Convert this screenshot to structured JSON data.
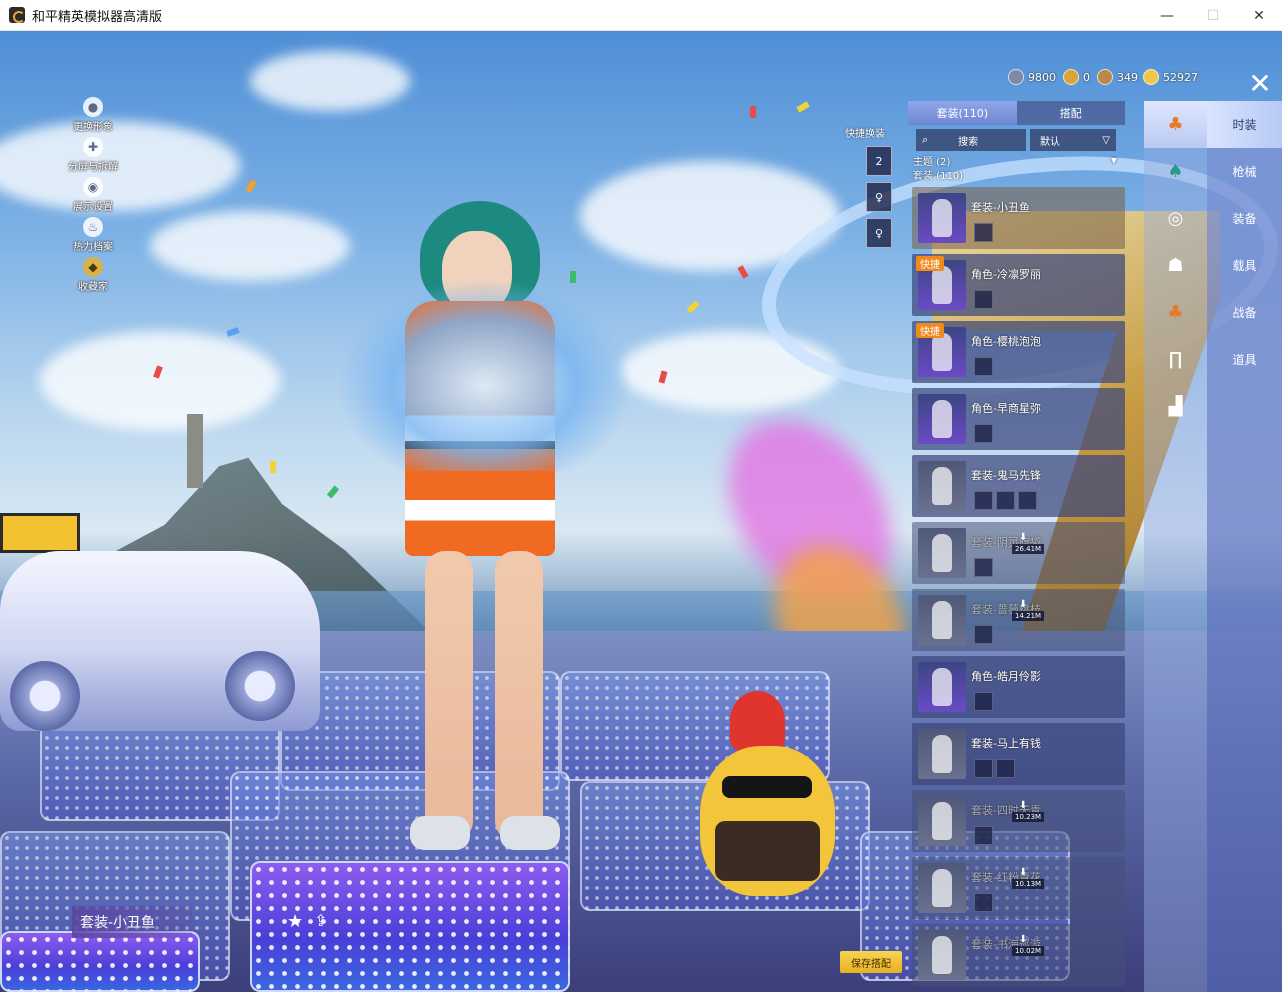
{
  "window": {
    "title": "和平精英模拟器高清版",
    "minimize": "—",
    "maximize": "☐",
    "close": "✕"
  },
  "side_menu": [
    {
      "label": "更换形象",
      "icon": "person-icon"
    },
    {
      "label": "分屏与拆解",
      "icon": "split-icon"
    },
    {
      "label": "展示设置",
      "icon": "eye-icon"
    },
    {
      "label": "热力档案",
      "icon": "flame-icon"
    },
    {
      "label": "收藏家",
      "icon": "collector-badge-icon"
    }
  ],
  "currency": [
    {
      "value": "9800",
      "color": "#7d8aa8"
    },
    {
      "value": "0",
      "color": "#d9a43a"
    },
    {
      "value": "349",
      "color": "#b88a4a"
    },
    {
      "value": "52927",
      "color": "#f0c64a"
    }
  ],
  "close_button": "✕",
  "categories": [
    "时装",
    "枪械",
    "装备",
    "载具",
    "战备",
    "道具"
  ],
  "panel": {
    "tabs": [
      "套装(110)",
      "搭配"
    ],
    "search_placeholder": "搜索",
    "sort_label": "默认",
    "sort_caret": "▽",
    "group_theme": "主题 (2)",
    "group_theme_caret": "▼",
    "group_suits": "套装 (110)"
  },
  "items": [
    {
      "name": "套装-小丑鱼",
      "badge": "",
      "download": ""
    },
    {
      "name": "角色-冷凛罗丽",
      "badge": "快捷",
      "download": ""
    },
    {
      "name": "角色-樱桃泡泡",
      "badge": "快捷",
      "download": ""
    },
    {
      "name": "角色-早商星弥",
      "badge": "",
      "download": ""
    },
    {
      "name": "套装-鬼马先锋",
      "badge": "",
      "download": ""
    },
    {
      "name": "套装-阴灵旗袋",
      "badge": "",
      "download": "26.41M"
    },
    {
      "name": "套装-蔷薇桃枝",
      "badge": "",
      "download": "14.21M"
    },
    {
      "name": "角色-皓月伶影",
      "badge": "",
      "download": ""
    },
    {
      "name": "套装-马上有钱",
      "badge": "",
      "download": ""
    },
    {
      "name": "套装-四时天青",
      "badge": "",
      "download": "10.23M"
    },
    {
      "name": "套装-红粉青花",
      "badge": "",
      "download": "10.13M"
    },
    {
      "name": "套装-书海巡游",
      "badge": "",
      "download": "10.02M"
    }
  ],
  "quick_swap": {
    "label": "快捷换装",
    "slot_number": "2"
  },
  "outfit_name": "套装-小丑鱼",
  "star_icon": "★",
  "share_icon": "⇪",
  "save_button": "保存搭配"
}
